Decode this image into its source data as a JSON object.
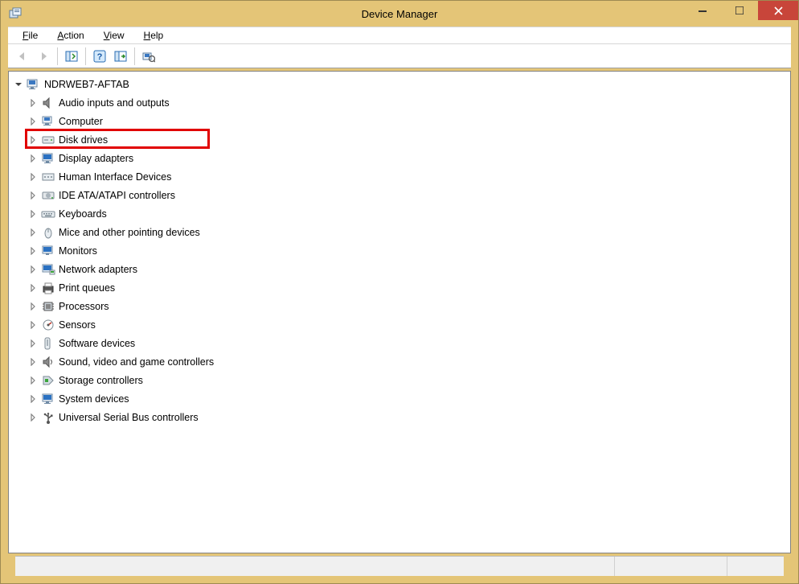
{
  "window": {
    "title": "Device Manager"
  },
  "menu": {
    "file": "File",
    "action": "Action",
    "view": "View",
    "help": "Help"
  },
  "tree": {
    "root": "NDRWEB7-AFTAB",
    "items": [
      {
        "label": "Audio inputs and outputs",
        "icon": "audio"
      },
      {
        "label": "Computer",
        "icon": "computer"
      },
      {
        "label": "Disk drives",
        "icon": "disk",
        "highlighted": true
      },
      {
        "label": "Display adapters",
        "icon": "display"
      },
      {
        "label": "Human Interface Devices",
        "icon": "hid"
      },
      {
        "label": "IDE ATA/ATAPI controllers",
        "icon": "ide"
      },
      {
        "label": "Keyboards",
        "icon": "keyboard"
      },
      {
        "label": "Mice and other pointing devices",
        "icon": "mouse"
      },
      {
        "label": "Monitors",
        "icon": "monitor"
      },
      {
        "label": "Network adapters",
        "icon": "network"
      },
      {
        "label": "Print queues",
        "icon": "printer"
      },
      {
        "label": "Processors",
        "icon": "cpu"
      },
      {
        "label": "Sensors",
        "icon": "sensor"
      },
      {
        "label": "Software devices",
        "icon": "software"
      },
      {
        "label": "Sound, video and game controllers",
        "icon": "sound"
      },
      {
        "label": "Storage controllers",
        "icon": "storage"
      },
      {
        "label": "System devices",
        "icon": "system"
      },
      {
        "label": "Universal Serial Bus controllers",
        "icon": "usb"
      }
    ]
  }
}
